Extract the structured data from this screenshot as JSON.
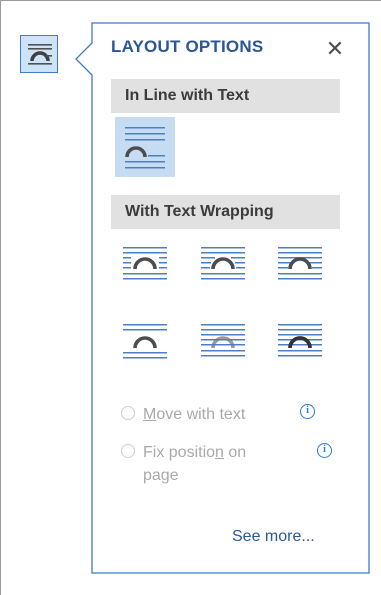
{
  "pane": {
    "title": "LAYOUT OPTIONS",
    "close_label": "✕"
  },
  "sections": {
    "inline": {
      "label": "In Line with Text"
    },
    "wrapping": {
      "label": "With Text Wrapping"
    }
  },
  "wrapping_options": [
    {
      "name": "square-wrap-icon"
    },
    {
      "name": "tight-wrap-icon"
    },
    {
      "name": "through-wrap-icon"
    },
    {
      "name": "top-and-bottom-wrap-icon"
    },
    {
      "name": "behind-text-icon"
    },
    {
      "name": "in-front-of-text-icon"
    }
  ],
  "position": {
    "move_with_text": {
      "prefix": "",
      "accel": "M",
      "suffix": "ove with text"
    },
    "fix_position": {
      "line1_prefix": "Fix positio",
      "accel": "n",
      "line1_suffix": " on",
      "line2": "page"
    },
    "info_glyph": "i"
  },
  "see_more": "See more...",
  "colors": {
    "accent": "#2b579a",
    "pane_border": "#3e7ac8",
    "selected_bg": "#c6dcf3",
    "section_bg": "#e1e1e1",
    "lines": "#4a7fc1",
    "arch": "#4d4d4d",
    "disabled_text": "#a9a9a9"
  }
}
